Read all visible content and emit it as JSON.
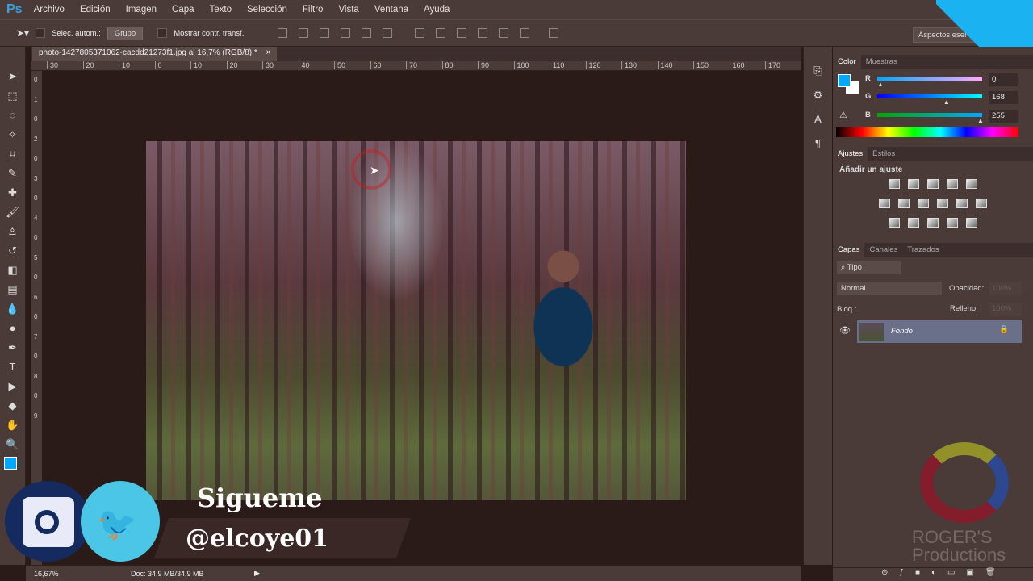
{
  "app": {
    "logo": "Ps"
  },
  "menu": [
    "Archivo",
    "Edición",
    "Imagen",
    "Capa",
    "Texto",
    "Selección",
    "Filtro",
    "Vista",
    "Ventana",
    "Ayuda"
  ],
  "options": {
    "auto_select_label": "Selec. autom.:",
    "group_value": "Grupo",
    "transform_label": "Mostrar contr. transf.",
    "workspace": "Aspectos esen."
  },
  "document": {
    "tab_title": "photo-1427805371062-cacdd21273f1.jpg al 16,7% (RGB/8) *",
    "close": "×"
  },
  "ruler": {
    "h_ticks": [
      "30",
      "20",
      "10",
      "0",
      "10",
      "20",
      "30",
      "40",
      "50",
      "60",
      "70",
      "80",
      "90",
      "100",
      "110",
      "120",
      "130",
      "140",
      "150",
      "160",
      "170"
    ],
    "v_ticks": [
      "0",
      "1",
      "0",
      "2",
      "0",
      "3",
      "0",
      "4",
      "0",
      "5",
      "0",
      "6",
      "0",
      "7",
      "0",
      "8",
      "0",
      "9"
    ]
  },
  "color_panel": {
    "tabs": [
      "Color",
      "Muestras"
    ],
    "channels": [
      {
        "label": "R",
        "value": "0",
        "fraction": 0
      },
      {
        "label": "G",
        "value": "168",
        "fraction": 0.66
      },
      {
        "label": "B",
        "value": "255",
        "fraction": 1
      }
    ],
    "foreground": "#00a8ff"
  },
  "adjust_panel": {
    "tabs": [
      "Ajustes",
      "Estilos"
    ],
    "heading": "Añadir un ajuste"
  },
  "layers_panel": {
    "tabs": [
      "Capas",
      "Canales",
      "Trazados"
    ],
    "filter": "Tipo",
    "blend_mode": "Normal",
    "opacity_label": "Opacidad:",
    "opacity_value": "100%",
    "lock_label": "Bloq.:",
    "fill_label": "Relleno:",
    "fill_value": "100%",
    "layers": [
      {
        "name": "Fondo",
        "locked": true,
        "visible": true
      }
    ]
  },
  "status": {
    "zoom": "16,67%",
    "doc": "Doc: 34,9 MB/34,9 MB"
  },
  "overlay": {
    "follow": "Sigueme",
    "handle": "@elcoye01",
    "watermark": "ROGER'S Productions"
  }
}
